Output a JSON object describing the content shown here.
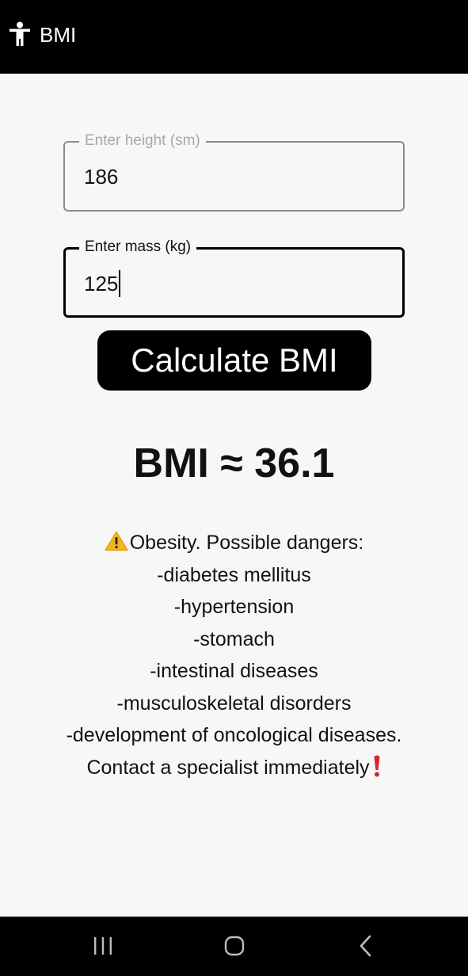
{
  "appbar": {
    "title": "BMI",
    "icon": "accessibility-person-icon"
  },
  "height_field": {
    "label": "Enter height (sm)",
    "value": "186"
  },
  "mass_field": {
    "label": "Enter mass (kg)",
    "value": "125"
  },
  "calculate_button": {
    "label": "Calculate BMI"
  },
  "result": {
    "text": "BMI ≈ 36.1"
  },
  "advice": {
    "warning_icon": "warning-icon",
    "lines": [
      "Obesity. Possible dangers:",
      "-diabetes mellitus",
      "-hypertension",
      "-stomach",
      "-intestinal diseases",
      "-musculoskeletal disorders",
      "-development of oncological diseases.",
      "Contact a specialist immediately"
    ],
    "end_icon": "exclamation-icon"
  },
  "navbar": {
    "recent": "recent-apps-icon",
    "home": "home-icon",
    "back": "back-icon"
  },
  "colors": {
    "appbar_bg": "#000000",
    "background": "#f7f7f7",
    "button_bg": "#000000",
    "warning": "#f2b51e",
    "exclamation": "#d9232e"
  }
}
